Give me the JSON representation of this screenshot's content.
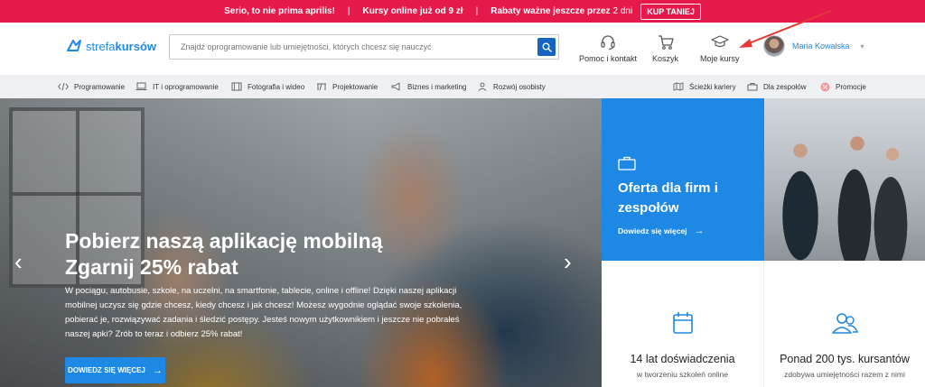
{
  "promo": {
    "item1": "Serio, to nie prima aprilis!",
    "sep": "|",
    "item2": "Kursy online już od 9 zł",
    "item3_bold": "Rabaty ważne jeszcze przez",
    "item3_light": "2 dni",
    "cta": "KUP TANIEJ"
  },
  "header": {
    "logo_a": "strefa",
    "logo_b": "kursów",
    "search_placeholder": "Znajdź oprogramowanie lub umiejętności, których chcesz się nauczyć",
    "help": "Pomoc i kontakt",
    "cart": "Koszyk",
    "my_courses": "Moje kursy",
    "user_name": "Maria Kowalska"
  },
  "nav": {
    "items": [
      {
        "label": "Programowanie",
        "icon": "code-icon"
      },
      {
        "label": "IT i oprogramowanie",
        "icon": "laptop-icon"
      },
      {
        "label": "Fotografia i wideo",
        "icon": "film-icon"
      },
      {
        "label": "Projektowanie",
        "icon": "design-icon"
      },
      {
        "label": "Biznes i marketing",
        "icon": "megaphone-icon"
      },
      {
        "label": "Rozwój osobisty",
        "icon": "person-icon"
      }
    ],
    "right": [
      {
        "label": "Ścieżki kariery",
        "icon": "map-icon"
      },
      {
        "label": "Dla zespołów",
        "icon": "briefcase-icon"
      },
      {
        "label": "Promocje",
        "icon": "percent-icon"
      }
    ]
  },
  "hero": {
    "title_line1": "Pobierz naszą aplikację mobilną",
    "title_line2": "Zgarnij 25% rabat",
    "body": "W pociągu, autobusie, szkole, na uczelni, na smartfonie, tablecie, online i offline! Dzięki naszej aplikacji mobilnej uczysz się gdzie chcesz, kiedy chcesz i jak chcesz! Możesz wygodnie oglądać swoje szkolenia, pobierać je, rozwiązywać zadania i śledzić postępy. Jesteś nowym użytkownikiem i jeszcze nie pobrałeś naszej apki? Zrób to teraz i odbierz 25% rabat!",
    "button": "DOWIEDZ SIĘ WIĘCEJ",
    "prev": "‹",
    "next": "›"
  },
  "business": {
    "title": "Oferta dla firm i zespołów",
    "link": "Dowiedz się więcej"
  },
  "stats": [
    {
      "value": "14 lat doświadczenia",
      "desc": "w tworzeniu szkoleń online",
      "icon": "calendar-icon"
    },
    {
      "value": "Ponad 200 tys. kursantów",
      "desc": "zdobywa umiejętności razem z nimi",
      "icon": "users-icon"
    }
  ],
  "colors": {
    "promo_bg": "#e6194b",
    "brand_blue": "#1e88e5",
    "search_button": "#1565c0",
    "annotation_arrow": "#e53935"
  }
}
